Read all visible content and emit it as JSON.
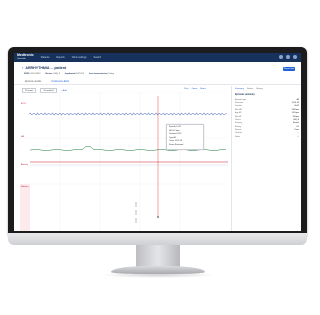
{
  "app": {
    "logo_primary": "Medtronic",
    "logo_secondary": "CareLink",
    "nav": [
      "Patients",
      "Reports",
      "Clinic settings",
      "Search"
    ],
    "page_title": "ARRHYTHMIA ... patient",
    "action_label": "Export data"
  },
  "meta": [
    {
      "label": "DOB",
      "value": "01/01/1950"
    },
    {
      "label": "Device",
      "value": "LINQ II"
    },
    {
      "label": "Implanted",
      "value": "02/2023"
    },
    {
      "label": "Last transmission",
      "value": "Today"
    }
  ],
  "tabs": [
    {
      "label": "Episode details",
      "active": false
    },
    {
      "label": "Continuous ECG",
      "active": true
    }
  ],
  "toolbar": {
    "view_select": "25 mm/s",
    "gain_select": "10 mm/mV",
    "add_label": "+ Add",
    "print_label": "Print",
    "zoom_label": "Zoom",
    "notes_label": "Notes"
  },
  "tracks": [
    {
      "label": "ECG",
      "color": "#2e5aa8"
    },
    {
      "label": "HR",
      "color": "#1f7a3c"
    },
    {
      "label": "Activity",
      "color": "#c0182b"
    },
    {
      "label": "Markers",
      "color": "#555555"
    }
  ],
  "tooltip": {
    "lines": [
      "Episode 14:32",
      "HR 142 bpm",
      "Duration 00:42",
      "Type AF",
      "Onset 14:31:58",
      "Status Reviewed"
    ]
  },
  "right_panel": {
    "tabs": [
      {
        "label": "Summary",
        "active": true
      },
      {
        "label": "Details",
        "active": false
      },
      {
        "label": "History",
        "active": false
      }
    ],
    "heading": "Episode summary",
    "rows": [
      {
        "k": "Episode type",
        "v": "AF"
      },
      {
        "k": "Start time",
        "v": "14:31:58"
      },
      {
        "k": "Duration",
        "v": "00:42"
      },
      {
        "k": "Max HR",
        "v": "168 bpm"
      },
      {
        "k": "Avg HR",
        "v": "142 bpm"
      },
      {
        "k": "Min HR",
        "v": "98 bpm"
      },
      {
        "k": "Device",
        "v": "LINQ II"
      },
      {
        "k": "Sensing",
        "v": "Normal"
      },
      {
        "k": "Battery",
        "v": "OK"
      },
      {
        "k": "Review",
        "v": "Done"
      },
      {
        "k": "Clinician",
        "v": "—"
      },
      {
        "k": "Notes",
        "v": "—"
      }
    ]
  }
}
